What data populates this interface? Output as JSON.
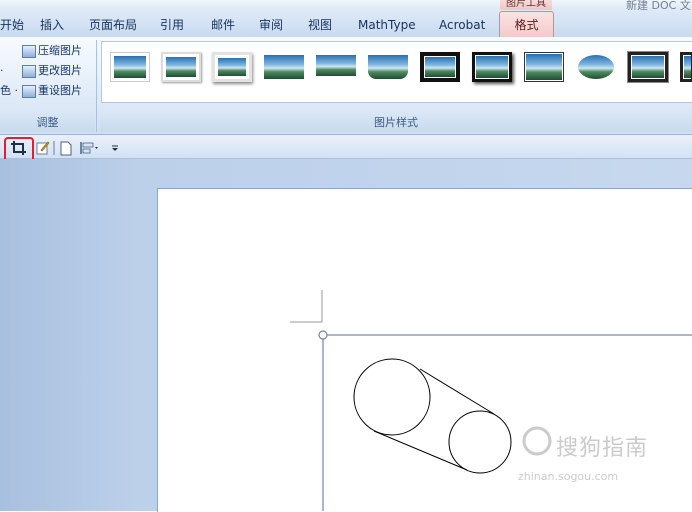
{
  "window": {
    "title": "新建 DOC 文",
    "tool_tab_header": "图片工具"
  },
  "tabs": [
    {
      "label": "开始"
    },
    {
      "label": "插入"
    },
    {
      "label": "页面布局"
    },
    {
      "label": "引用"
    },
    {
      "label": "邮件"
    },
    {
      "label": "审阅"
    },
    {
      "label": "视图"
    },
    {
      "label": "MathType"
    },
    {
      "label": "Acrobat"
    },
    {
      "label": "格式",
      "active": true
    }
  ],
  "ribbon": {
    "adjust_group": {
      "label": "调整",
      "items": [
        {
          "label": "压缩图片",
          "icon": "compress-picture-icon"
        },
        {
          "label": "更改图片",
          "icon": "change-picture-icon"
        },
        {
          "label": "重设图片",
          "icon": "reset-picture-icon"
        }
      ],
      "left_fragments": [
        "·",
        "色 ·"
      ]
    },
    "style_group": {
      "label": "图片样式",
      "thumb_count": 14
    }
  },
  "quick_access": {
    "buttons": [
      "crop-icon",
      "edit-icon",
      "page-icon",
      "align-icon",
      "more-dropdown-icon"
    ]
  },
  "watermark": {
    "text": "搜狗指南",
    "url": "zhinan.sogou.com"
  },
  "colors": {
    "accent": "#e0202a",
    "ribbon_blue": "#c8daf0",
    "format_tab": "#f3c9c9"
  }
}
